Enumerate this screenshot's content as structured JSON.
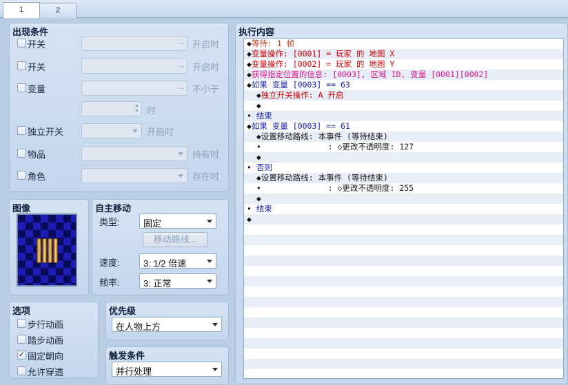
{
  "tabs": [
    "1",
    "2"
  ],
  "conditions": {
    "title": "出现条件",
    "switch1": {
      "label": "开关",
      "suffix": "开启时"
    },
    "switch2": {
      "label": "开关",
      "suffix": "开启时"
    },
    "variable": {
      "label": "变量",
      "suffix": "不小于",
      "time_suffix": "时"
    },
    "self_switch": {
      "label": "独立开关",
      "suffix": "开启时"
    },
    "item": {
      "label": "物品",
      "suffix": "持有时"
    },
    "actor": {
      "label": "角色",
      "suffix": "存在时"
    },
    "dots": "..."
  },
  "image": {
    "title": "图像"
  },
  "auto_move": {
    "title": "自主移动",
    "type_label": "类型:",
    "type_value": "固定",
    "route_button": "移动路线...",
    "speed_label": "速度:",
    "speed_value": "3: 1/2 倍速",
    "freq_label": "频率:",
    "freq_value": "3: 正常"
  },
  "options": {
    "title": "选项",
    "items": [
      {
        "label": "步行动画",
        "checked": false
      },
      {
        "label": "踏步动画",
        "checked": false
      },
      {
        "label": "固定朝向",
        "checked": true
      },
      {
        "label": "允许穿透",
        "checked": false
      }
    ],
    "checkmark": "✓"
  },
  "priority": {
    "title": "优先级",
    "value": "在人物上方"
  },
  "trigger": {
    "title": "触发条件",
    "value": "并行处理"
  },
  "commands": {
    "title": "执行内容",
    "lines": [
      {
        "segments": [
          {
            "t": "◆",
            "c": "c-black"
          },
          {
            "t": "等待: 1 帧",
            "c": "c-orange"
          }
        ]
      },
      {
        "segments": [
          {
            "t": "◆",
            "c": "c-black"
          },
          {
            "t": "变量操作: [0001] = 玩家 的 地图 X",
            "c": "c-red"
          }
        ]
      },
      {
        "segments": [
          {
            "t": "◆",
            "c": "c-black"
          },
          {
            "t": "变量操作: [0002] = 玩家 的 地图 Y",
            "c": "c-red"
          }
        ]
      },
      {
        "segments": [
          {
            "t": "◆",
            "c": "c-black"
          },
          {
            "t": "获得指定位置的信息: [0003], 区域 ID, 变量 [0001][0002]",
            "c": "c-magenta"
          }
        ]
      },
      {
        "segments": [
          {
            "t": "◆",
            "c": "c-black"
          },
          {
            "t": "如果 变量 [0003] == 63",
            "c": "c-blue"
          }
        ]
      },
      {
        "segments": [
          {
            "t": "  ◆",
            "c": "c-black"
          },
          {
            "t": "独立开关操作: A 开启",
            "c": "c-red"
          }
        ]
      },
      {
        "segments": [
          {
            "t": "  ◆",
            "c": "c-black"
          }
        ]
      },
      {
        "segments": [
          {
            "t": "• ",
            "c": "c-black"
          },
          {
            "t": "结束",
            "c": "c-blue"
          }
        ]
      },
      {
        "segments": [
          {
            "t": "◆",
            "c": "c-black"
          },
          {
            "t": "如果 变量 [0003] == 61",
            "c": "c-blue"
          }
        ]
      },
      {
        "segments": [
          {
            "t": "  ◆设置移动路线: 本事件 (等待结束)",
            "c": "c-dark"
          }
        ]
      },
      {
        "segments": [
          {
            "t": "  •              : ◇更改不透明度: 127",
            "c": "c-dark"
          }
        ]
      },
      {
        "segments": [
          {
            "t": "  ◆",
            "c": "c-black"
          }
        ]
      },
      {
        "segments": [
          {
            "t": "• ",
            "c": "c-black"
          },
          {
            "t": "否则",
            "c": "c-blue"
          }
        ]
      },
      {
        "segments": [
          {
            "t": "  ◆设置移动路线: 本事件 (等待结束)",
            "c": "c-dark"
          }
        ]
      },
      {
        "segments": [
          {
            "t": "  •              : ◇更改不透明度: 255",
            "c": "c-dark"
          }
        ]
      },
      {
        "segments": [
          {
            "t": "  ◆",
            "c": "c-black"
          }
        ]
      },
      {
        "segments": [
          {
            "t": "• ",
            "c": "c-black"
          },
          {
            "t": "结束",
            "c": "c-blue"
          }
        ]
      },
      {
        "segments": [
          {
            "t": "◆",
            "c": "c-black"
          }
        ]
      }
    ]
  },
  "colors": {
    "panel": "#c9daef",
    "accent": "#8ea7c8",
    "list_alt_row": "#e7eef7"
  }
}
